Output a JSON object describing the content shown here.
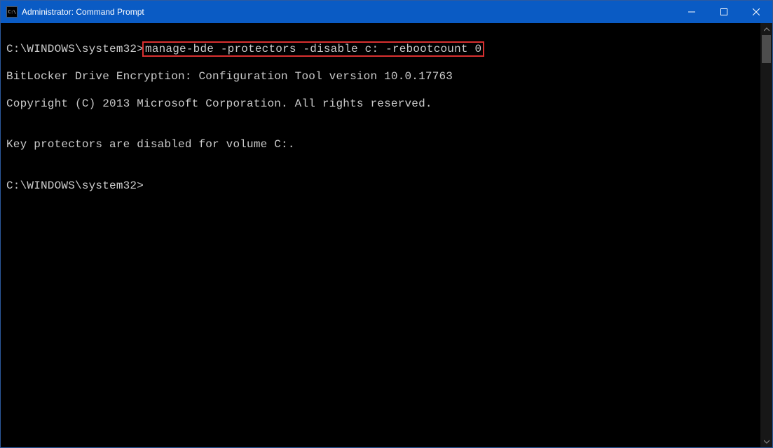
{
  "titlebar": {
    "icon_label": "C:\\",
    "title": "Administrator: Command Prompt"
  },
  "console": {
    "prompt1": "C:\\WINDOWS\\system32>",
    "command": "manage-bde -protectors -disable c: -rebootcount 0",
    "output_line1": "BitLocker Drive Encryption: Configuration Tool version 10.0.17763",
    "output_line2": "Copyright (C) 2013 Microsoft Corporation. All rights reserved.",
    "blank1": "",
    "output_line3": "Key protectors are disabled for volume C:.",
    "blank2": "",
    "prompt2": "C:\\WINDOWS\\system32>"
  }
}
